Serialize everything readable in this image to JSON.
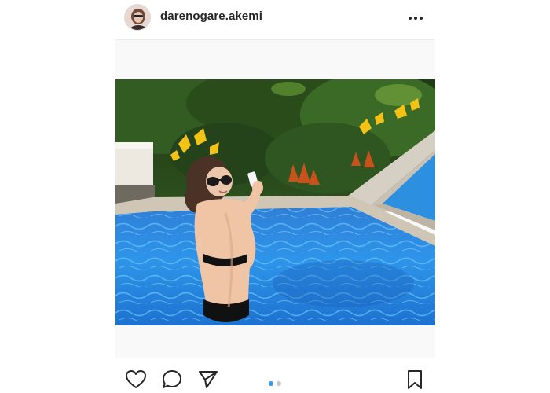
{
  "post": {
    "username": "darenogare.akemi",
    "avatar_icon": "profile-photo",
    "more_icon": "more-horizontal-icon",
    "carousel": {
      "current_slide": 1,
      "total_slides": 2
    }
  },
  "colors": {
    "text": "#262626",
    "active_dot": "#3897f0",
    "inactive_dot": "#c7c7c7",
    "divider": "#ececec"
  },
  "actions": {
    "like_icon": "heart-icon",
    "comment_icon": "comment-icon",
    "share_icon": "send-icon",
    "save_icon": "bookmark-icon"
  }
}
